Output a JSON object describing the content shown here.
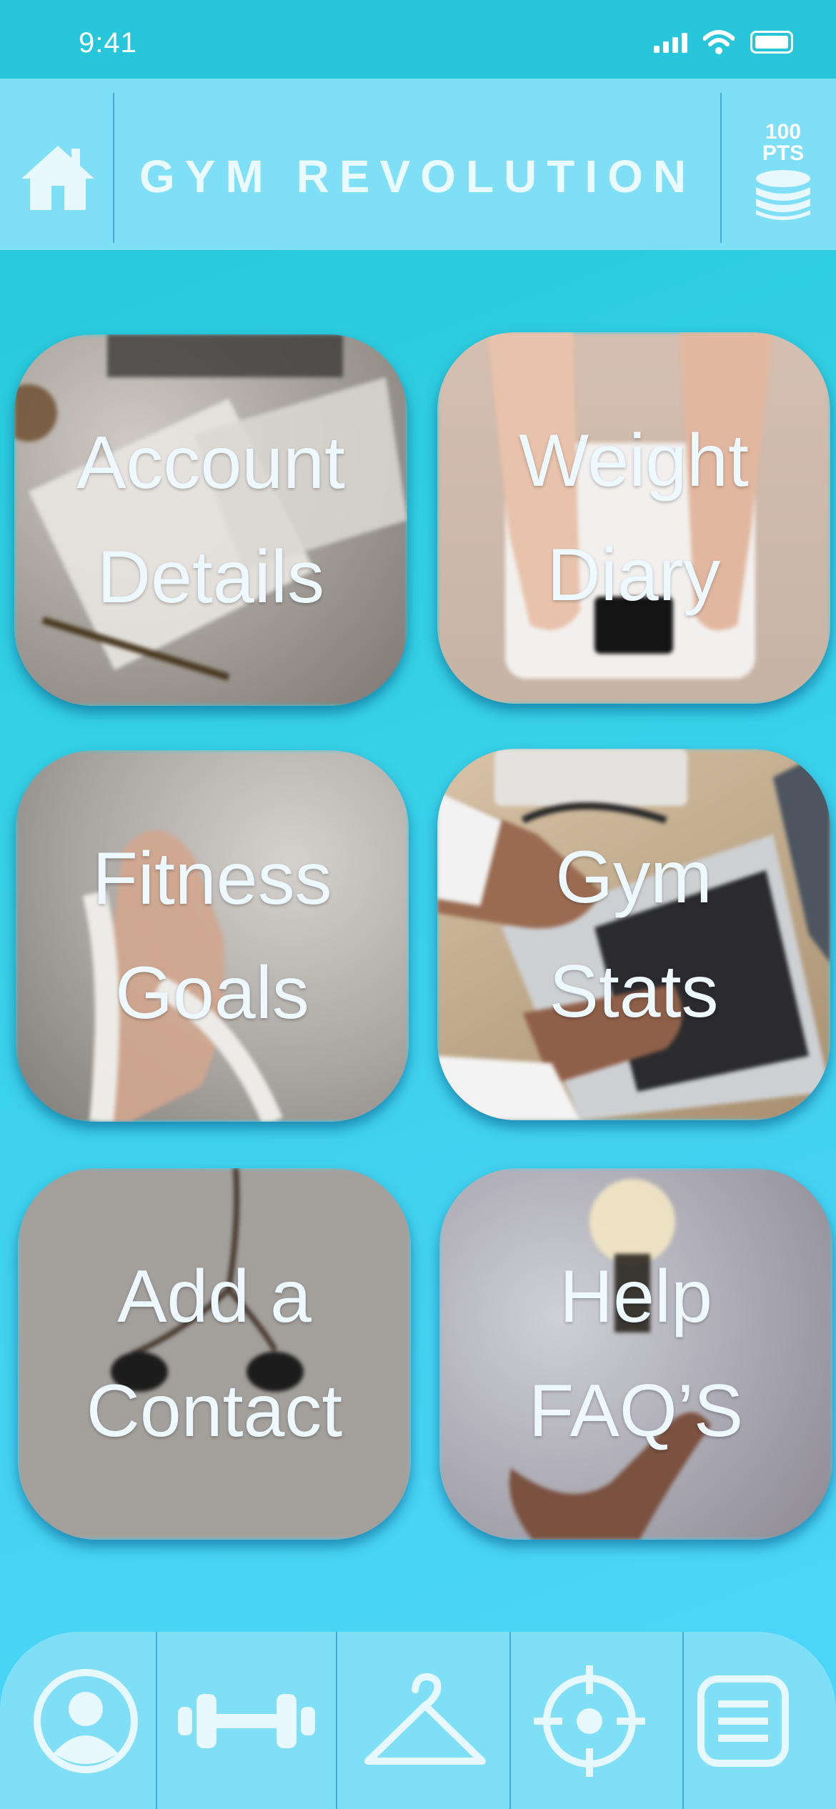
{
  "status_bar": {
    "time": "9:41"
  },
  "header": {
    "title": "GYM REVOLUTION",
    "points_value": "100",
    "points_unit": "PTS"
  },
  "tiles": [
    {
      "line1": "Account",
      "line2": "Details"
    },
    {
      "line1": "Weight",
      "line2": "Diary"
    },
    {
      "line1": "Fitness",
      "line2": "Goals"
    },
    {
      "line1": "Gym",
      "line2": "Stats"
    },
    {
      "line1": "Add a",
      "line2": "Contact"
    },
    {
      "line1": "Help",
      "line2": "FAQ’S"
    }
  ],
  "bottom_nav": {
    "icons": [
      "profile-icon",
      "dumbbell-icon",
      "hanger-icon",
      "target-icon",
      "notes-icon"
    ]
  },
  "colors": {
    "background_start": "#1fc6d6",
    "background_end": "#4fd6fa",
    "header": "#7fdff7",
    "divider": "#4aa8d4",
    "icon": "#e8f8ff"
  }
}
